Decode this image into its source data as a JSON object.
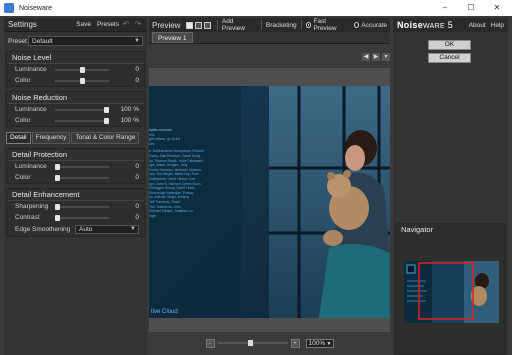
{
  "window": {
    "title": "Noiseware",
    "min": "–",
    "max": "☐",
    "close": "✕"
  },
  "left": {
    "title": "Settings",
    "save": "Save",
    "presets": "Presets",
    "preset_label": "Preset",
    "preset_value": "Default",
    "noise_level": {
      "title": "Noise Level",
      "rows": [
        {
          "label": "Luminance",
          "value": "0",
          "level": 0.5
        },
        {
          "label": "Color",
          "value": "0",
          "level": 0.5
        }
      ]
    },
    "noise_reduction": {
      "title": "Noise Reduction",
      "rows": [
        {
          "label": "Luminance",
          "value": "100",
          "unit": "%",
          "level": 1.0
        },
        {
          "label": "Color",
          "value": "100",
          "unit": "%",
          "level": 1.0
        }
      ]
    },
    "tabs": [
      "Detail",
      "Frequency",
      "Tonal & Color Range"
    ],
    "detail_protection": {
      "title": "Detail Protection",
      "rows": [
        {
          "label": "Luminance",
          "value": "0",
          "level": 0.0
        },
        {
          "label": "Color",
          "value": "0",
          "level": 0.0
        }
      ]
    },
    "detail_enhancement": {
      "title": "Detail Enhancement",
      "rows": [
        {
          "label": "Sharpening",
          "value": "0",
          "level": 0.0
        },
        {
          "label": "Contrast",
          "value": "0",
          "level": 0.0
        }
      ],
      "edge_label": "Edge Smoothening",
      "edge_value": "Auto"
    }
  },
  "center": {
    "title": "Preview",
    "add_preview": "Add Preview",
    "bracketing": "Bracketing",
    "fast_preview": "Fast Preview",
    "accurate": "Accurate",
    "tab": "Preview 1",
    "zoom": "100%",
    "zoom_minus": "-",
    "zoom_plus": "+",
    "image_text": {
      "rights": "rights reserved.",
      "lines": [
        "ens",
        "gal notices, go to the",
        "ces.",
        "s: Seetharaman Narayanan, Russell",
        "Overy, Alan Erickson, Sarah Kong,",
        "Ipi, Thomas Ruark, Yukie Takahashi,",
        "ppe, Adam Jerugim, Judy",
        "Foster Brereton, Meredith Stotzner,",
        "nan, Tim Wright, Maria Yap, Pam",
        "Gulfbaman, David Hackel, Eric",
        "ppo, John E. Hanson, Derek Novo,",
        "Zhengyun Zheng, David Howe,",
        "Shanmugh Natarajan, Prasav",
        "nu, Anirudh Singh, Brittany",
        "Jeff Tranberry, Ruchi",
        "Tom Townsend, John",
        "Michael Vitrano, Jonathan Lo,",
        "inger"
      ],
      "cloud": "tive Cloud"
    }
  },
  "right": {
    "brand_a": "Noise",
    "brand_b": "ware",
    "brand_ver": "5",
    "about": "About",
    "help": "Help",
    "ok": "OK",
    "cancel": "Cancel",
    "navigator": "Navigator"
  },
  "colors": {
    "accent": "#3a7bd5",
    "nav_box": "#e02020"
  }
}
